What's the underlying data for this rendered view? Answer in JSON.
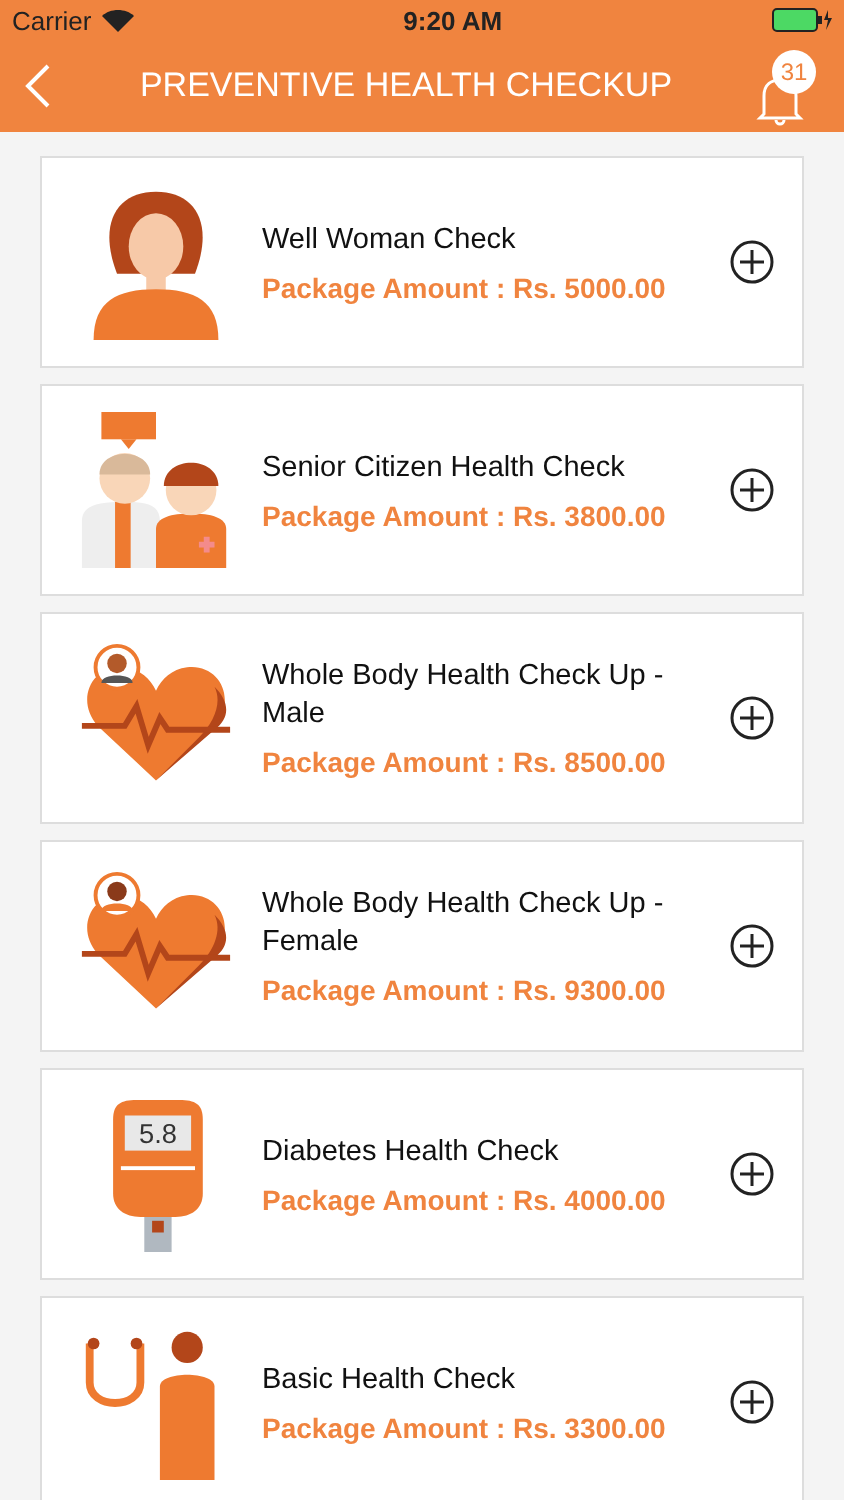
{
  "status_bar": {
    "carrier": "Carrier",
    "time": "9:20 AM"
  },
  "header": {
    "title": "PREVENTIVE HEALTH CHECKUP",
    "notification_count": "31"
  },
  "packages": [
    {
      "kind": "woman",
      "name": "Well Woman Check",
      "amount": "Package Amount : Rs. 5000.00"
    },
    {
      "kind": "seniors",
      "name": "Senior Citizen Health Check",
      "amount": "Package Amount : Rs. 3800.00"
    },
    {
      "kind": "heart-male",
      "name": "Whole Body Health Check Up - Male",
      "amount": "Package Amount : Rs. 8500.00"
    },
    {
      "kind": "heart-female",
      "name": "Whole Body Health Check Up - Female",
      "amount": "Package Amount : Rs. 9300.00"
    },
    {
      "kind": "meter",
      "icon_text": "5.8",
      "name": "Diabetes Health Check",
      "amount": "Package Amount : Rs. 4000.00"
    },
    {
      "kind": "stethoscope",
      "name": "Basic Health Check",
      "amount": "Package Amount : Rs. 3300.00"
    }
  ]
}
